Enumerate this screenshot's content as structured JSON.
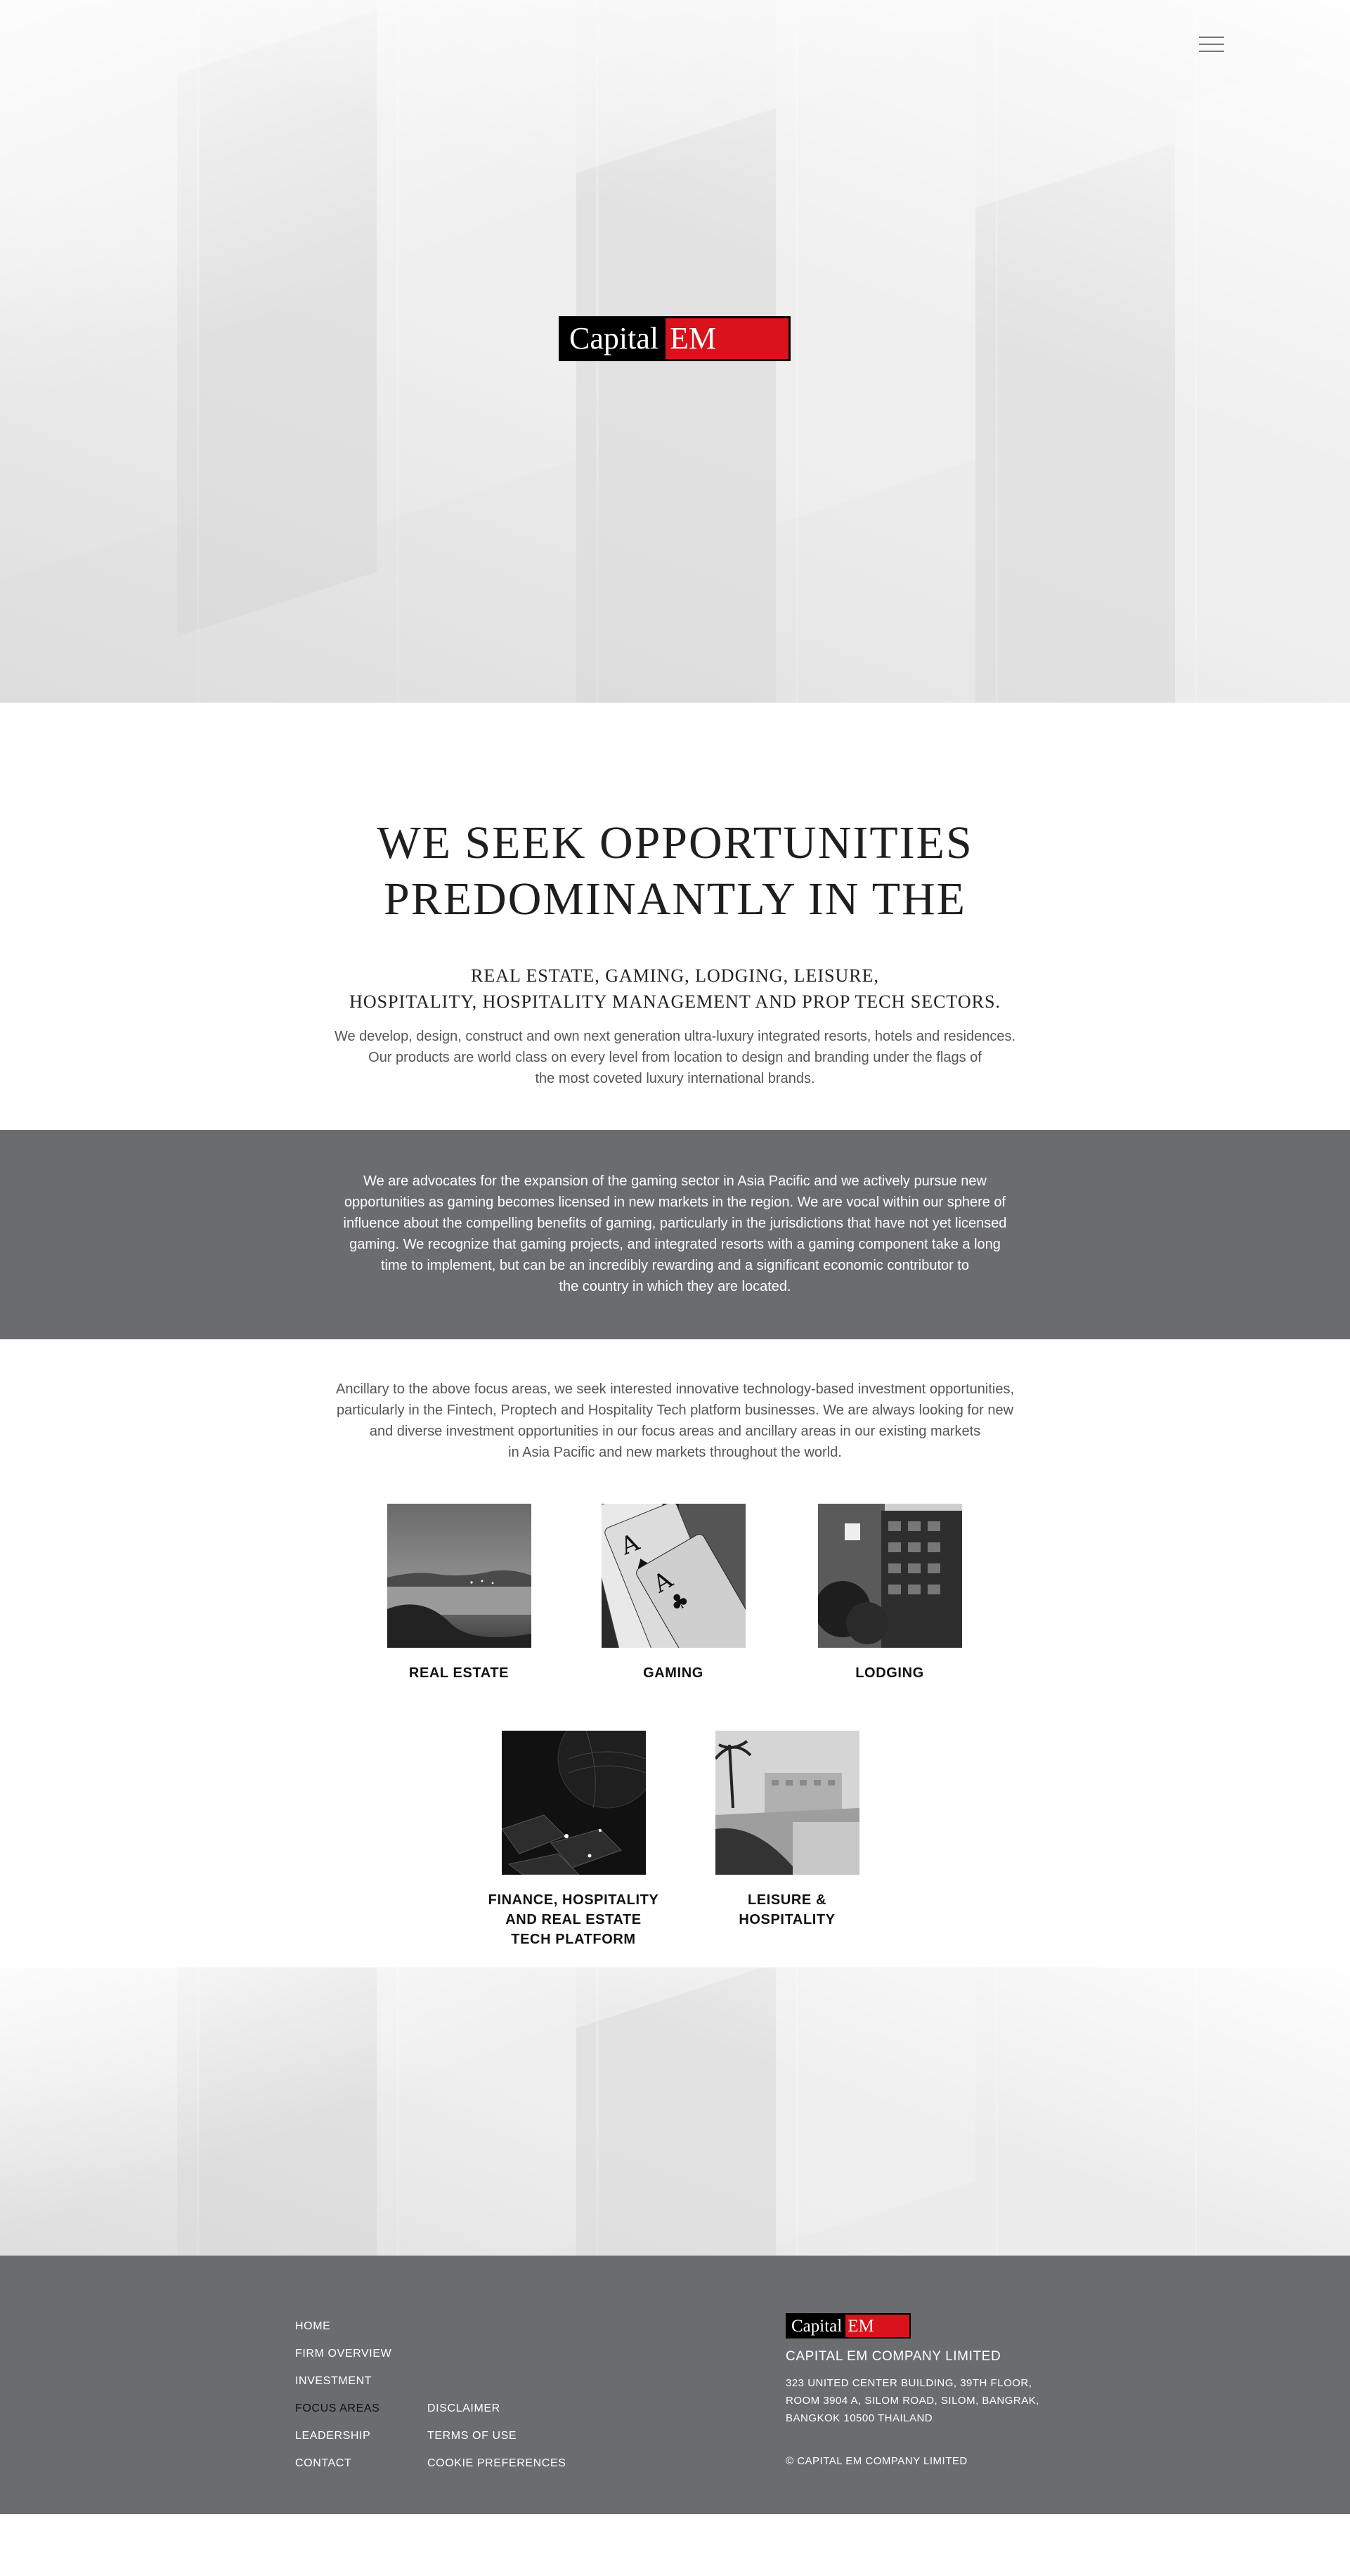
{
  "brand": {
    "logo_part1": "Capital",
    "logo_part2": "EM",
    "logo_accent_color": "#d9121b",
    "logo_bg_color": "#000000"
  },
  "header": {
    "menu_icon": "hamburger-menu-icon"
  },
  "intro": {
    "headline_line1": "WE SEEK OPPORTUNITIES",
    "headline_line2": "PREDOMINANTLY IN THE",
    "sectors_line1": "REAL ESTATE, GAMING, LODGING, LEISURE,",
    "sectors_line2": "HOSPITALITY, HOSPITALITY MANAGEMENT AND PROP TECH SECTORS.",
    "body_line1": "We develop, design, construct and own next generation ultra-luxury integrated resorts, hotels and residences.",
    "body_line2": "Our products are world class on every level from location to design and branding under the flags of",
    "body_line3": "the most coveted luxury international brands."
  },
  "advocacy": {
    "line1": "We are advocates for the expansion of the gaming sector in Asia Pacific and we actively pursue new",
    "line2": "opportunities as gaming becomes licensed in new markets in the region. We are vocal within our sphere of",
    "line3": "influence about the compelling benefits of gaming, particularly in the jurisdictions that have not yet licensed",
    "line4": "gaming. We recognize that gaming projects, and integrated resorts with a gaming component take a long",
    "line5": "time to implement, but can be an incredibly rewarding and a significant economic  contributor to",
    "line6": "the country in which they are located.",
    "band_color": "#6b6c70"
  },
  "ancillary": {
    "line1": "Ancillary to the above focus areas, we seek interested innovative technology-based investment opportunities,",
    "line2": "particularly in the Fintech, Proptech and Hospitality Tech platform businesses. We are always looking for new",
    "line3": "and diverse investment opportunities in our focus areas and ancillary areas in our existing markets",
    "line4": "in Asia Pacific and new markets throughout the world."
  },
  "focus_areas": [
    {
      "label": "REAL ESTATE"
    },
    {
      "label": "GAMING"
    },
    {
      "label": "LODGING"
    },
    {
      "label": "FINANCE, HOSPITALITY\nAND REAL ESTATE\nTECH PLATFORM"
    },
    {
      "label": "LEISURE  &\nHOSPITALITY"
    }
  ],
  "footer": {
    "nav": [
      "HOME",
      "FIRM OVERVIEW",
      "INVESTMENT",
      "FOCUS AREAS",
      "LEADERSHIP",
      "CONTACT"
    ],
    "nav_active": "FOCUS AREAS",
    "legal": [
      "DISCLAIMER",
      "TERMS OF USE",
      "COOKIE PREFERENCES"
    ],
    "company_name": "CAPITAL EM COMPANY LIMITED",
    "address": "323 UNITED CENTER BUILDING, 39TH FLOOR,\nROOM 3904 A, SILOM ROAD, SILOM, BANGRAK,\nBANGKOK 10500 THAILAND",
    "copyright": "© CAPITAL EM COMPANY LIMITED"
  }
}
